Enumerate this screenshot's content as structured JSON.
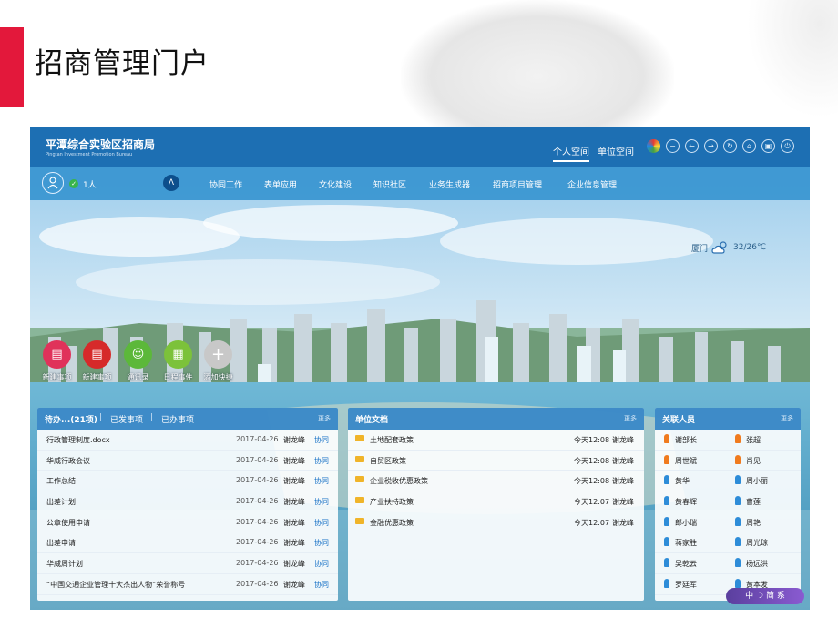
{
  "slide": {
    "title": "招商管理门户",
    "accent_color": "#e3183b"
  },
  "portal": {
    "title": "平潭综合实验区招商局",
    "subtitle": "Pingtan Investment Promotion Bureau",
    "tabs": [
      "个人空间",
      "单位空间"
    ],
    "active_tab": "个人空间",
    "header_icons": [
      "color-wheel-icon",
      "minus-circle-icon",
      "back-circle-icon",
      "forward-circle-icon",
      "refresh-circle-icon",
      "home-circle-icon",
      "lock-circle-icon",
      "power-circle-icon"
    ]
  },
  "navbar": {
    "online_count": "1人",
    "home_icon": "Λ",
    "items": [
      "协同工作",
      "表单应用",
      "文化建设",
      "知识社区",
      "业务生成器",
      "招商项目管理",
      "企业信息管理"
    ]
  },
  "weather": {
    "city": "厦门",
    "temp": "32/26℃",
    "icon": "cloud-sun-icon"
  },
  "shortcuts": [
    {
      "label": "新建事项",
      "color": "#e0325a",
      "icon": "doc-icon"
    },
    {
      "label": "新建事项",
      "color": "#d62a2a",
      "icon": "doc-icon"
    },
    {
      "label": "通讯录",
      "color": "#5cb83a",
      "icon": "contact-icon"
    },
    {
      "label": "日程事件",
      "color": "#7cc23a",
      "icon": "calendar-icon"
    },
    {
      "label": "添加快捷",
      "color": "#c8c8c8",
      "icon": "plus-icon"
    }
  ],
  "pending": {
    "tabs": [
      "待办...(21项)",
      "已发事项",
      "已办事项"
    ],
    "more": "更多",
    "rows": [
      {
        "title": "行政管理制度.docx",
        "date": "2017-04-26",
        "person": "谢龙峰",
        "type": "协同"
      },
      {
        "title": "华威行政会议",
        "date": "2017-04-26",
        "person": "谢龙峰",
        "type": "协同"
      },
      {
        "title": "工作总结",
        "date": "2017-04-26",
        "person": "谢龙峰",
        "type": "协同"
      },
      {
        "title": "出差计划",
        "date": "2017-04-26",
        "person": "谢龙峰",
        "type": "协同"
      },
      {
        "title": "公章使用申请",
        "date": "2017-04-26",
        "person": "谢龙峰",
        "type": "协同"
      },
      {
        "title": "出差申请",
        "date": "2017-04-26",
        "person": "谢龙峰",
        "type": "协同"
      },
      {
        "title": "华威周计划",
        "date": "2017-04-26",
        "person": "谢龙峰",
        "type": "协同"
      },
      {
        "title": "“中国交通企业管理十大杰出人物”荣誉称号",
        "date": "2017-04-26",
        "person": "谢龙峰",
        "type": "协同"
      }
    ]
  },
  "documents": {
    "title": "单位文档",
    "more": "更多",
    "rows": [
      {
        "title": "土地配套政策",
        "time": "今天12:08",
        "person": "谢龙峰"
      },
      {
        "title": "自贸区政策",
        "time": "今天12:08",
        "person": "谢龙峰"
      },
      {
        "title": "企业税收优惠政策",
        "time": "今天12:08",
        "person": "谢龙峰"
      },
      {
        "title": "产业扶持政策",
        "time": "今天12:07",
        "person": "谢龙峰"
      },
      {
        "title": "金融优惠政策",
        "time": "今天12:07",
        "person": "谢龙峰"
      }
    ]
  },
  "contacts": {
    "title": "关联人员",
    "more": "更多",
    "people": [
      {
        "name": "谢部长",
        "color": "#f07b1e"
      },
      {
        "name": "张超",
        "color": "#f07b1e"
      },
      {
        "name": "周世斌",
        "color": "#f07b1e"
      },
      {
        "name": "肖见",
        "color": "#f07b1e"
      },
      {
        "name": "黄华",
        "color": "#2d8cd8"
      },
      {
        "name": "周小丽",
        "color": "#2d8cd8"
      },
      {
        "name": "黄春辉",
        "color": "#2d8cd8"
      },
      {
        "name": "曹莲",
        "color": "#2d8cd8"
      },
      {
        "name": "郎小瑞",
        "color": "#2d8cd8"
      },
      {
        "name": "周艳",
        "color": "#2d8cd8"
      },
      {
        "name": "蒋家胜",
        "color": "#2d8cd8"
      },
      {
        "name": "周光琼",
        "color": "#2d8cd8"
      },
      {
        "name": "吴乾云",
        "color": "#2d8cd8"
      },
      {
        "name": "杨远洪",
        "color": "#2d8cd8"
      },
      {
        "name": "罗廷军",
        "color": "#2d8cd8"
      },
      {
        "name": "黄本发",
        "color": "#2d8cd8"
      }
    ]
  },
  "widget": {
    "text": "中 ☽ 简 系"
  }
}
